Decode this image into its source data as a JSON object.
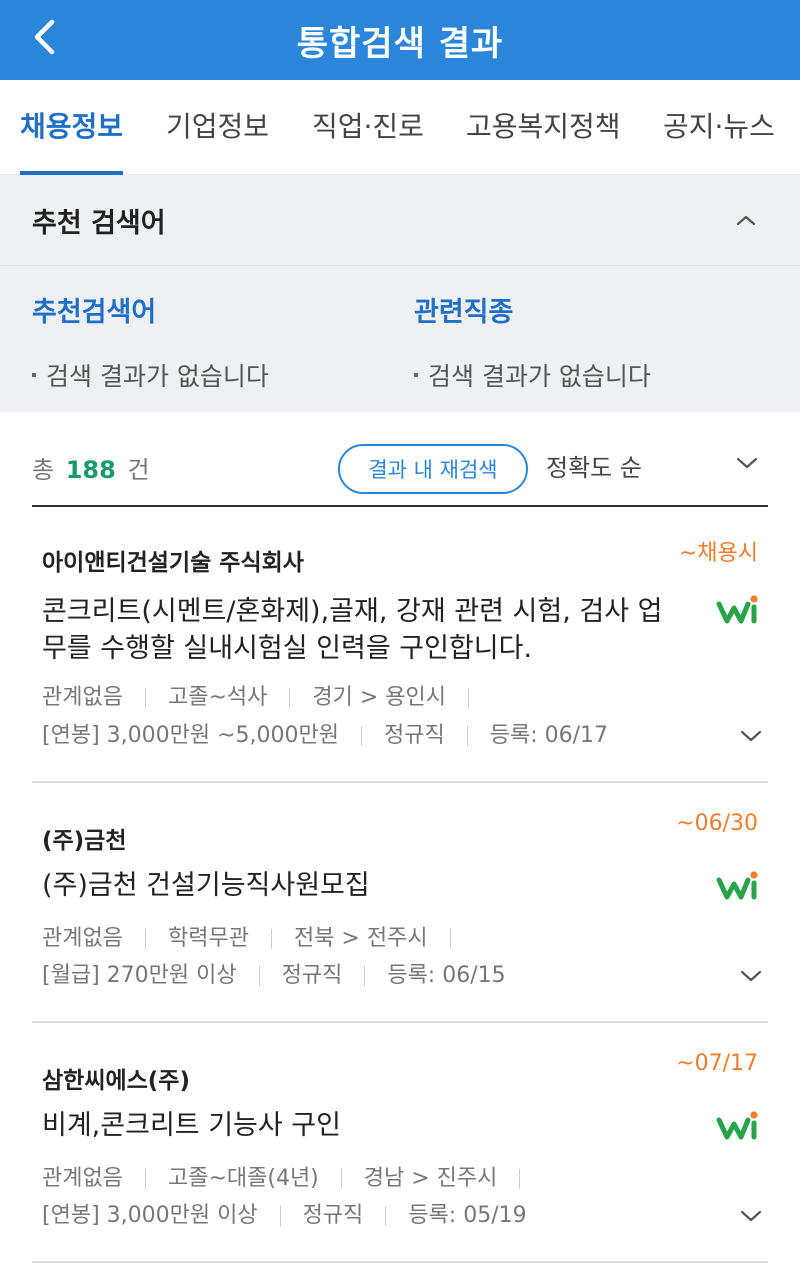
{
  "header": {
    "title": "통합검색 결과",
    "back_icon": "chevron-left-icon"
  },
  "tabs": [
    {
      "label": "채용정보",
      "active": true
    },
    {
      "label": "기업정보",
      "active": false
    },
    {
      "label": "직업·진로",
      "active": false
    },
    {
      "label": "고용복지정책",
      "active": false
    },
    {
      "label": "공지·뉴스",
      "active": false
    }
  ],
  "recommend": {
    "section_title": "추천 검색어",
    "collapse_icon": "chevron-up-icon",
    "columns": [
      {
        "title": "추천검색어",
        "empty_text": "검색 결과가 없습니다"
      },
      {
        "title": "관련직종",
        "empty_text": "검색 결과가 없습니다"
      }
    ]
  },
  "summary": {
    "prefix": "총",
    "count": "188",
    "suffix": "건",
    "research_label": "결과 내 재검색",
    "sort_label": "정확도 순"
  },
  "jobs": [
    {
      "company": "아이앤티건설기술 주식회사",
      "deadline": "~채용시",
      "title": "콘크리트(시멘트/혼화제),골재, 강재 관련 시험, 검사 업무를 수행할 실내시험실 인력을 구인합니다.",
      "meta1": [
        "관계없음",
        "고졸~석사",
        "경기 > 용인시"
      ],
      "meta2": [
        "[연봉] 3,000만원 ~5,000만원",
        "정규직",
        "등록: 06/17"
      ]
    },
    {
      "company": "(주)금천",
      "deadline": "~06/30",
      "title": "(주)금천 건설기능직사원모집",
      "meta1": [
        "관계없음",
        "학력무관",
        "전북 > 전주시"
      ],
      "meta2": [
        "[월급] 270만원 이상",
        "정규직",
        "등록: 06/15"
      ]
    },
    {
      "company": "삼한씨에스(주)",
      "deadline": "~07/17",
      "title": "비계,콘크리트 기능사 구인",
      "meta1": [
        "관계없음",
        "고졸~대졸(4년)",
        "경남 > 진주시"
      ],
      "meta2": [
        "[연봉] 3,000만원 이상",
        "정규직",
        "등록: 05/19"
      ]
    }
  ],
  "colors": {
    "header": "#2b86d9",
    "active_tab": "#1f6fc5",
    "count": "#1a9a6a",
    "deadline": "#f07d2b",
    "logo_green": "#27a34a",
    "logo_orange": "#f07d2b"
  }
}
